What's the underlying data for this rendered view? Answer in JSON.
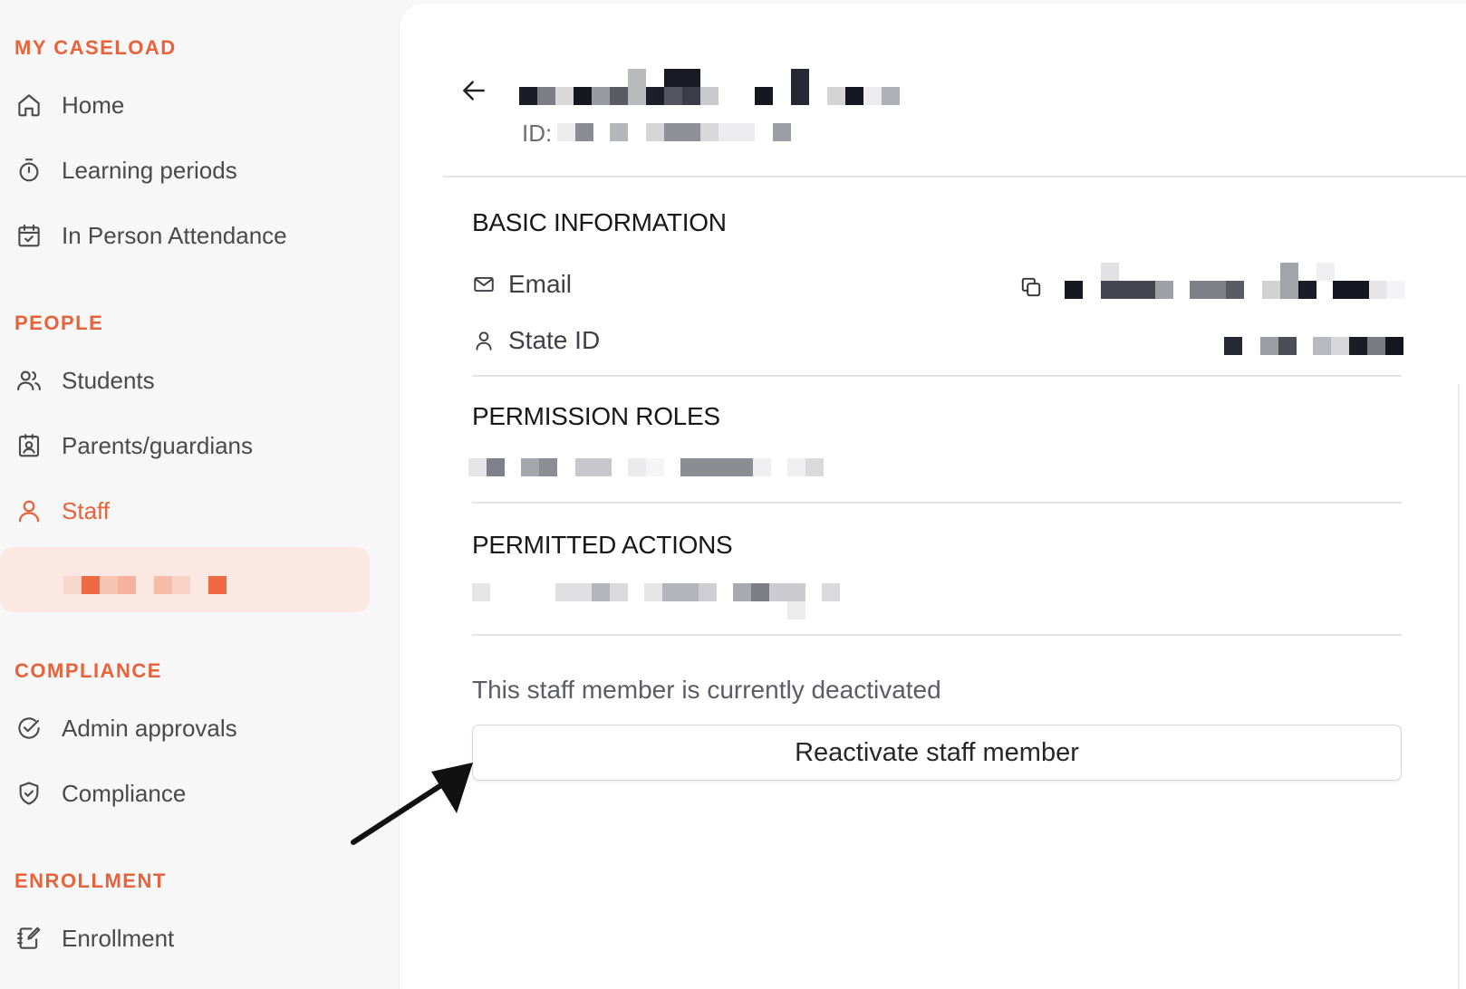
{
  "sidebar": {
    "sections": {
      "caseload": "MY CASELOAD",
      "people": "PEOPLE",
      "compliance": "COMPLIANCE",
      "enrollment": "ENROLLMENT"
    },
    "items": {
      "home": "Home",
      "learning_periods": "Learning periods",
      "in_person_attendance": "In Person Attendance",
      "students": "Students",
      "parents_guardians": "Parents/guardians",
      "staff": "Staff",
      "admin_approvals": "Admin approvals",
      "compliance": "Compliance",
      "enrollment": "Enrollment"
    },
    "accent_color": "#e8623a",
    "active_item": "Staff"
  },
  "header": {
    "id_prefix": "ID:",
    "back_icon": "arrow-left-icon"
  },
  "basic_information": {
    "title": "BASIC INFORMATION",
    "email_label": "Email",
    "state_id_label": "State ID"
  },
  "permission_roles": {
    "title": "PERMISSION ROLES"
  },
  "permitted_actions": {
    "title": "PERMITTED ACTIONS"
  },
  "status": {
    "deactivated_text": "This staff member is currently deactivated",
    "reactivate_label": "Reactivate staff member"
  }
}
